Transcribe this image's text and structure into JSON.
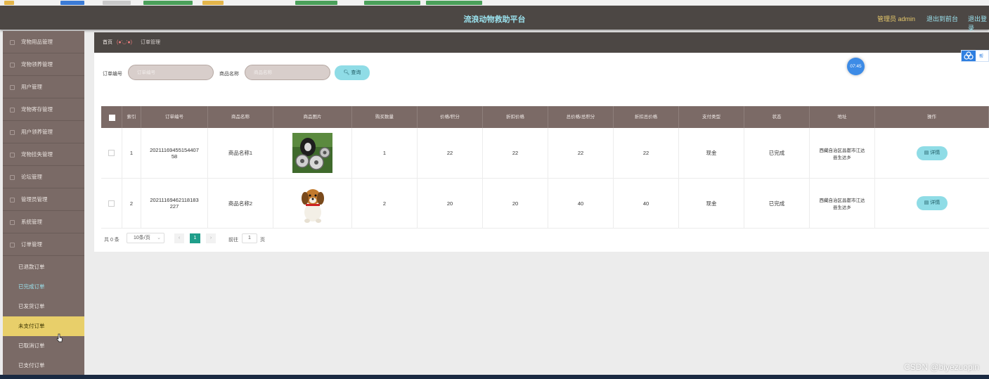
{
  "header": {
    "title": "流浪动物救助平台",
    "admin": "管理员 admin",
    "link_front": "退出到前台",
    "link_logout": "退出登录"
  },
  "sidebar": {
    "items": [
      {
        "label": "宠物用品管理"
      },
      {
        "label": "宠物领养管理"
      },
      {
        "label": "用户管理"
      },
      {
        "label": "宠物寄存管理"
      },
      {
        "label": "用户领养管理"
      },
      {
        "label": "宠物挂失管理"
      },
      {
        "label": "论坛管理"
      },
      {
        "label": "管理员管理"
      },
      {
        "label": "系统管理"
      },
      {
        "label": "订单管理"
      }
    ],
    "subitems": [
      {
        "label": "已退款订单"
      },
      {
        "label": "已完成订单"
      },
      {
        "label": "已发货订单"
      },
      {
        "label": "未支付订单"
      },
      {
        "label": "已取消订单"
      },
      {
        "label": "已支付订单"
      }
    ]
  },
  "breadcrumb": {
    "home": "首页",
    "emoticon": "(●'◡'●)",
    "current": "订单管理"
  },
  "search": {
    "order_label": "订单编号",
    "order_placeholder": "订单编号",
    "name_label": "商品名称",
    "name_placeholder": "商品名称",
    "button": "查询"
  },
  "badge": {
    "time": "07:45",
    "side_tab": "帮"
  },
  "table": {
    "headers": [
      "索引",
      "订单编号",
      "商品名称",
      "商品图片",
      "购买数量",
      "价格/积分",
      "折扣价格",
      "总价格/总积分",
      "折扣总价格",
      "支付类型",
      "状态",
      "地址",
      "操作"
    ],
    "rows": [
      {
        "index": "1",
        "order_no": "2021116945515440758",
        "order_no_l1": "20211169455154407",
        "order_no_l2": "58",
        "name": "商品名称1",
        "qty": "1",
        "price": "22",
        "discount": "22",
        "total": "22",
        "discount_total": "22",
        "pay": "现金",
        "status": "已完成",
        "addr_l1": "西藏自治区昌都市江达",
        "addr_l2": "县生达乡",
        "action": "详情"
      },
      {
        "index": "2",
        "order_no": "20211169462118183227",
        "order_no_l1": "20211169462118183",
        "order_no_l2": "227",
        "name": "商品名称2",
        "qty": "2",
        "price": "20",
        "discount": "20",
        "total": "40",
        "discount_total": "40",
        "pay": "现金",
        "status": "已完成",
        "addr_l1": "西藏自治区昌都市江达",
        "addr_l2": "县生达乡",
        "action": "详情"
      }
    ]
  },
  "pagination": {
    "total": "共 0 条",
    "page_size": "10条/页",
    "current_page": "1",
    "goto_label": "前往",
    "goto_value": "1",
    "page_unit": "页"
  },
  "watermark": "CSDN @biyezuopin",
  "colors": {
    "topbar": "#4c4744",
    "sidebar": "#7a6a66",
    "accent": "#8fdce6",
    "highlight": "#e8cf6a",
    "pager": "#1f9e8a"
  }
}
